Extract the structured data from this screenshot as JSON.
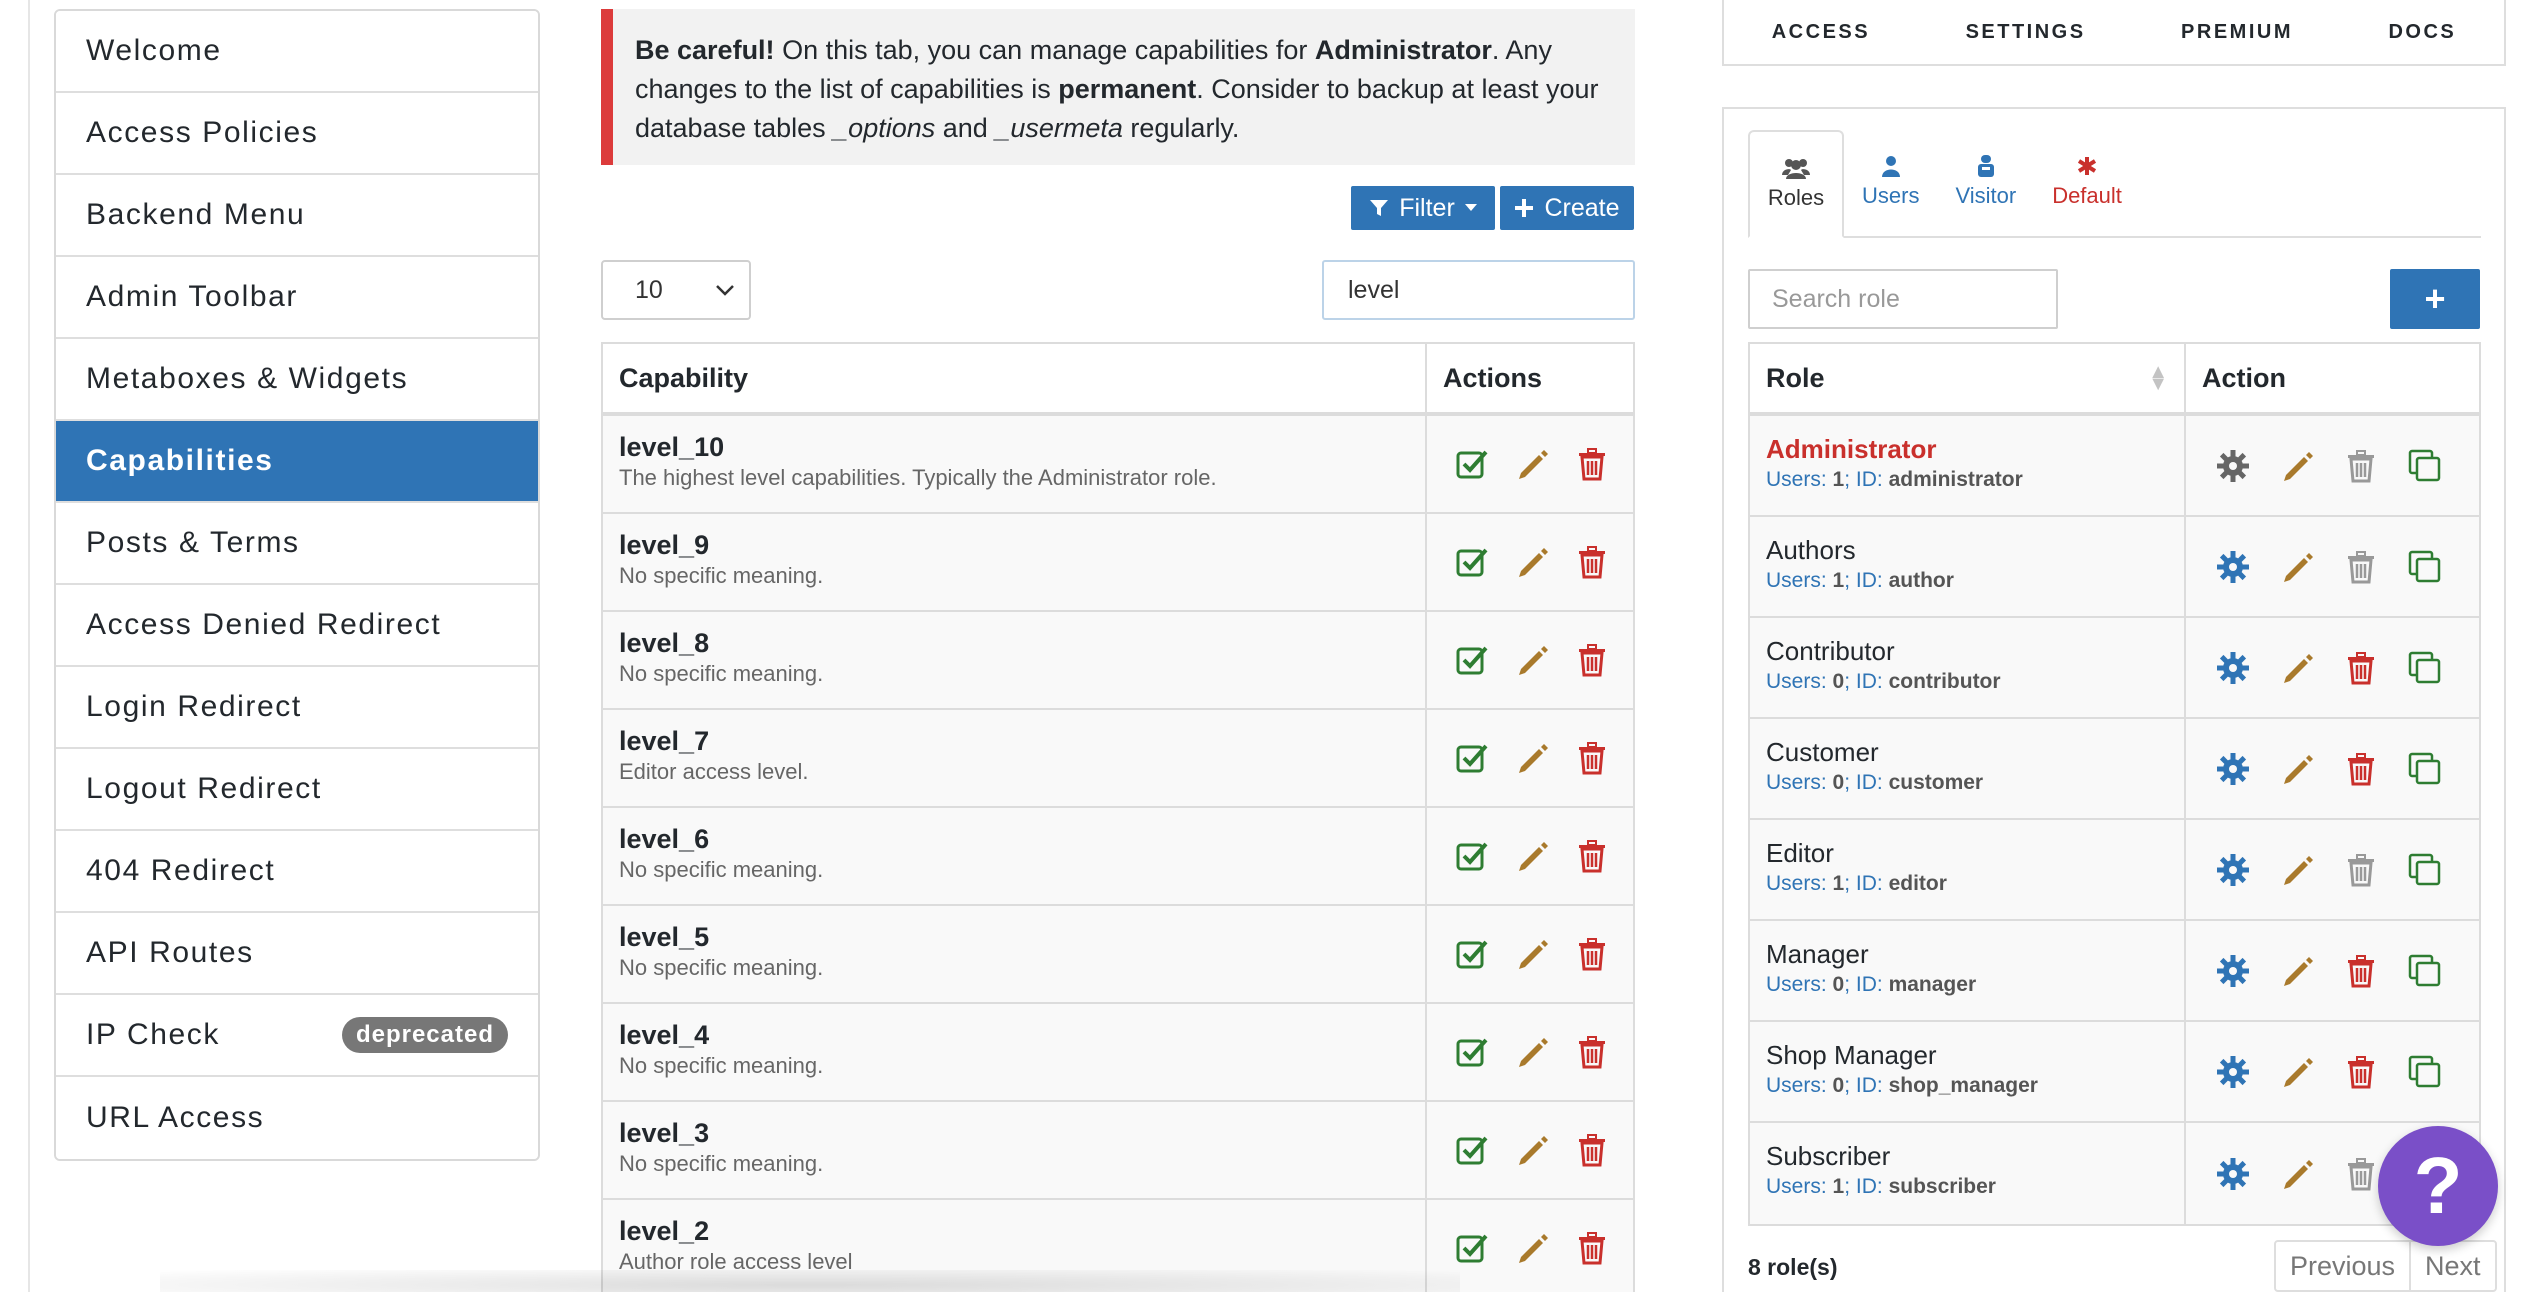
{
  "nav": {
    "items": [
      {
        "label": "Welcome"
      },
      {
        "label": "Access Policies"
      },
      {
        "label": "Backend Menu"
      },
      {
        "label": "Admin Toolbar"
      },
      {
        "label": "Metaboxes & Widgets"
      },
      {
        "label": "Capabilities",
        "active": true
      },
      {
        "label": "Posts & Terms"
      },
      {
        "label": "Access Denied Redirect"
      },
      {
        "label": "Login Redirect"
      },
      {
        "label": "Logout Redirect"
      },
      {
        "label": "404 Redirect"
      },
      {
        "label": "API Routes"
      },
      {
        "label": "IP Check",
        "badge": "deprecated"
      },
      {
        "label": "URL Access"
      }
    ]
  },
  "notice": {
    "bold_lead": "Be careful!",
    "text1": " On this tab, you can manage capabilities for ",
    "role": "Administrator",
    "text2": ". Any changes to the list of capabilities is ",
    "permanent": "permanent",
    "text3": ". Consider to backup at least your database tables ",
    "table1": "_options",
    "text4": " and ",
    "table2": "_usermeta",
    "text5": " regularly."
  },
  "toolbar": {
    "filter_label": "Filter",
    "create_label": "Create"
  },
  "page_size": "10",
  "cap_search": "level",
  "cap_table": {
    "headers": {
      "capability": "Capability",
      "actions": "Actions"
    },
    "rows": [
      {
        "name": "level_10",
        "desc": "The highest level capabilities. Typically the Administrator role."
      },
      {
        "name": "level_9",
        "desc": "No specific meaning."
      },
      {
        "name": "level_8",
        "desc": "No specific meaning."
      },
      {
        "name": "level_7",
        "desc": "Editor access level."
      },
      {
        "name": "level_6",
        "desc": "No specific meaning."
      },
      {
        "name": "level_5",
        "desc": "No specific meaning."
      },
      {
        "name": "level_4",
        "desc": "No specific meaning."
      },
      {
        "name": "level_3",
        "desc": "No specific meaning."
      },
      {
        "name": "level_2",
        "desc": "Author role access level"
      }
    ]
  },
  "top_menu": {
    "access": "ACCESS",
    "settings": "SETTINGS",
    "premium": "PREMIUM",
    "docs": "DOCS"
  },
  "tabs": {
    "roles": "Roles",
    "users": "Users",
    "visitor": "Visitor",
    "default": "Default"
  },
  "role_search": {
    "placeholder": "Search role"
  },
  "role_table": {
    "headers": {
      "role": "Role",
      "action": "Action"
    },
    "users_label": "Users:",
    "id_label": "ID:",
    "rows": [
      {
        "name": "Administrator",
        "users": "1",
        "id": "administrator",
        "current": true
      },
      {
        "name": "Authors",
        "users": "1",
        "id": "author"
      },
      {
        "name": "Contributor",
        "users": "0",
        "id": "contributor"
      },
      {
        "name": "Customer",
        "users": "0",
        "id": "customer"
      },
      {
        "name": "Editor",
        "users": "1",
        "id": "editor"
      },
      {
        "name": "Manager",
        "users": "0",
        "id": "manager"
      },
      {
        "name": "Shop Manager",
        "users": "0",
        "id": "shop_manager"
      },
      {
        "name": "Subscriber",
        "users": "1",
        "id": "subscriber"
      }
    ]
  },
  "role_count": "8 role(s)",
  "pager": {
    "previous": "Previous",
    "next": "Next"
  },
  "help": "?",
  "colors": {
    "primary": "#2f74b5",
    "danger": "#c9302c",
    "success": "#2e7d32",
    "edit": "#a97a2c",
    "help": "#7a4fc8"
  }
}
